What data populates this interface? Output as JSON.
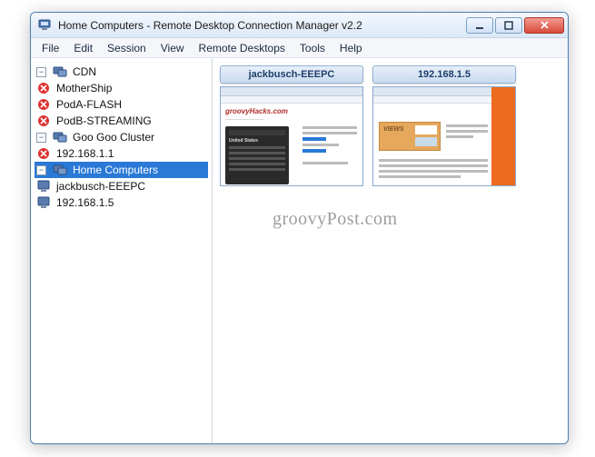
{
  "window": {
    "title": "Home Computers - Remote Desktop Connection Manager v2.2"
  },
  "menu": {
    "file": "File",
    "edit": "Edit",
    "session": "Session",
    "view": "View",
    "remote_desktops": "Remote Desktops",
    "tools": "Tools",
    "help": "Help"
  },
  "tree": {
    "groups": [
      {
        "label": "CDN",
        "expanded": true,
        "nodes": [
          {
            "label": "MotherShip",
            "status": "disconnected"
          },
          {
            "label": "PodA-FLASH",
            "status": "disconnected"
          },
          {
            "label": "PodB-STREAMING",
            "status": "disconnected"
          }
        ]
      },
      {
        "label": "Goo Goo Cluster",
        "expanded": true,
        "nodes": [
          {
            "label": "192.168.1.1",
            "status": "disconnected"
          }
        ]
      },
      {
        "label": "Home Computers",
        "expanded": true,
        "selected": true,
        "nodes": [
          {
            "label": "jackbusch-EEEPC",
            "status": "connected"
          },
          {
            "label": "192.168.1.5",
            "status": "connected"
          }
        ]
      }
    ]
  },
  "thumbnails": [
    {
      "title": "jackbusch-EEEPC",
      "page": {
        "brand": "groovyHacks.com",
        "panel_heading": "United States"
      }
    },
    {
      "title": "192.168.1.5",
      "page": {
        "banner_text": "VIEWS"
      }
    }
  ],
  "watermark": "groovyPost.com"
}
